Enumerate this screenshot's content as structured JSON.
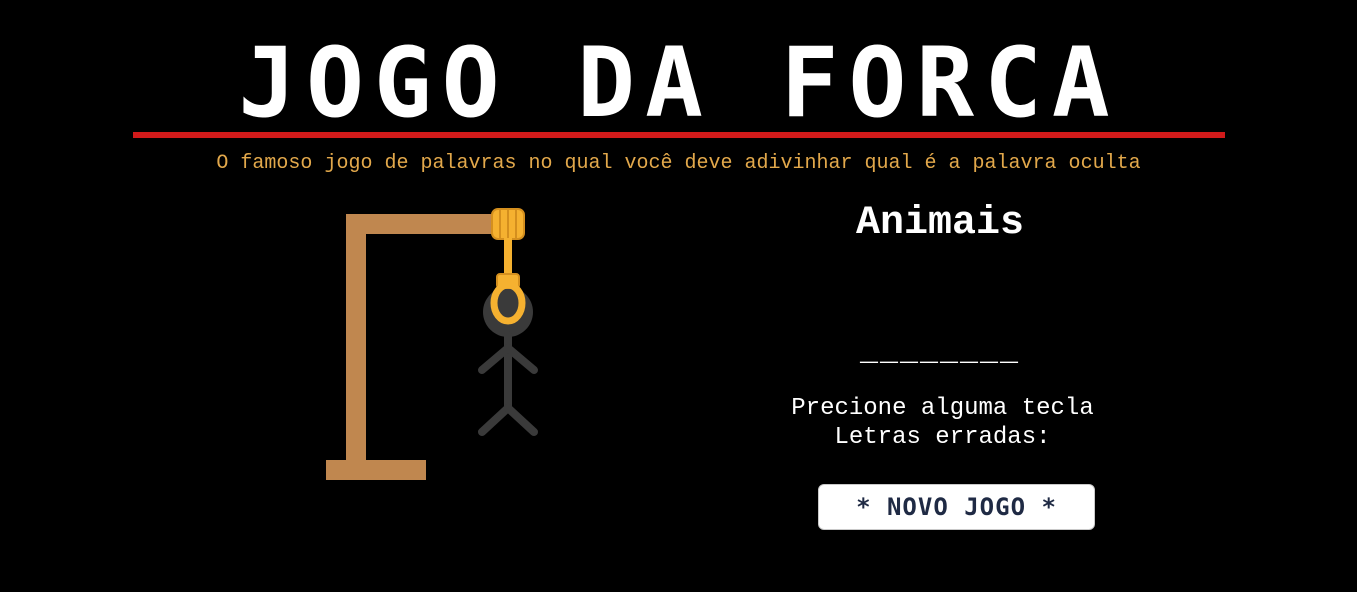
{
  "header": {
    "title": "JOGO DA FORCA",
    "subtitle": "O famoso jogo de palavras no qual você deve adivinhar qual é a palavra oculta"
  },
  "game": {
    "category": "Animais",
    "word_mask": "________",
    "hint": "Precione alguma tecla",
    "wrong_letters_label": "Letras erradas:",
    "new_game_label": "* NOVO JOGO *"
  },
  "colors": {
    "background": "#000000",
    "title_rule": "#d11a1a",
    "subtitle": "#e2a84b",
    "gallows_wood": "#c0874f",
    "rope": "#f5b130",
    "stickman": "#3a3a3a"
  },
  "icons": {
    "gallows": "gallows-icon",
    "noose": "noose-icon",
    "stickman": "stickman-icon"
  }
}
